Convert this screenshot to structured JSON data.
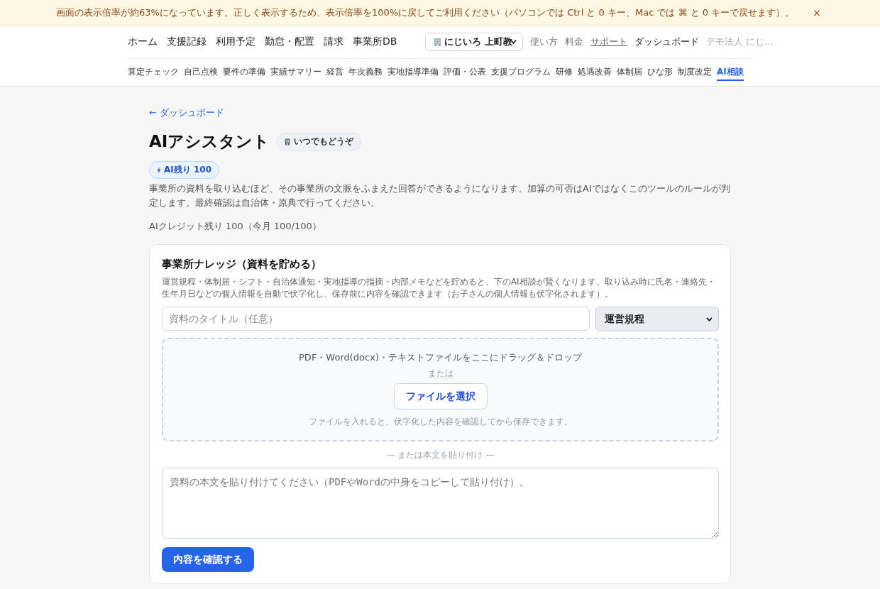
{
  "notice_banner": {
    "message": "画面の表示倍率が約63%になっています。正しく表示するため、表示倍率を100%に戻してご利用ください（パソコンでは Ctrl と 0 キー、Mac では ⌘ と 0 キーで戻せます）。",
    "close": "×"
  },
  "header": {
    "main_nav": [
      {
        "label": "ホーム"
      },
      {
        "label": "支援記録"
      },
      {
        "label": "利用予定"
      },
      {
        "label": "勤怠・配置"
      },
      {
        "label": "請求"
      },
      {
        "label": "事業所DB"
      }
    ],
    "office_select": {
      "value": "にじいろ 上町教"
    },
    "links": [
      {
        "label": "使い方",
        "kind": "muted"
      },
      {
        "label": "料金",
        "kind": "muted"
      },
      {
        "label": "サポート",
        "kind": "underlined"
      },
      {
        "label": "ダッシュボード",
        "kind": "strong"
      },
      {
        "label": "デモ法人 にじ…",
        "kind": "faint"
      }
    ],
    "sub_nav": [
      {
        "label": "算定チェック",
        "selected": false
      },
      {
        "label": "自己点検",
        "selected": false
      },
      {
        "label": "要件の準備",
        "selected": false
      },
      {
        "label": "実績サマリー",
        "selected": false
      },
      {
        "label": "経営",
        "selected": false
      },
      {
        "label": "年次義務",
        "selected": false
      },
      {
        "label": "実地指導準備",
        "selected": false
      },
      {
        "label": "評価・公表",
        "selected": false
      },
      {
        "label": "支援プログラム",
        "selected": false
      },
      {
        "label": "研修",
        "selected": false
      },
      {
        "label": "処遇改善",
        "selected": false
      },
      {
        "label": "体制届",
        "selected": false
      },
      {
        "label": "ひな形",
        "selected": false
      },
      {
        "label": "制度改定",
        "selected": false
      },
      {
        "label": "AI相談",
        "selected": true
      }
    ]
  },
  "back_link": "← ダッシュボード",
  "page": {
    "title": "AIアシスタント",
    "badge": "いつでもどうぞ",
    "credit_chip": "AI残り 100",
    "description": "事業所の資料を取り込むほど、その事業所の文脈をふまえた回答ができるようになります。加算の可否はAIではなくこのツールのルールが判定します。最終確認は自治体・原典で行ってください。",
    "credit_text": "AIクレジット残り 100（今月 100/100）"
  },
  "knowledge_card": {
    "title": "事業所ナレッジ（資料を貯める）",
    "description": "運営規程・体制届・シフト・自治体通知・実地指導の指摘・内部メモなどを貯めると、下のAI相談が賢くなります。取り込み時に氏名・連絡先・生年月日などの個人情報を自動で伏字化し、保存前に内容を確認できます（お子さんの個人情報も伏字化されます）。",
    "title_input": {
      "placeholder": "資料のタイトル（任意）"
    },
    "category_select": {
      "value": "運営規程"
    },
    "dropzone": {
      "instruction": "PDF・Word(docx)・テキストファイルをここにドラッグ＆ドロップ",
      "or": "または",
      "button": "ファイルを選択",
      "hint": "ファイルを入れると、伏字化した内容を確認してから保存できます。"
    },
    "paste_divider": "— または本文を貼り付け —",
    "body_input": {
      "placeholder": "資料の本文を貼り付けてください（PDFやWordの中身をコピーして貼り付け）。"
    },
    "submit_button": "内容を確認する"
  }
}
